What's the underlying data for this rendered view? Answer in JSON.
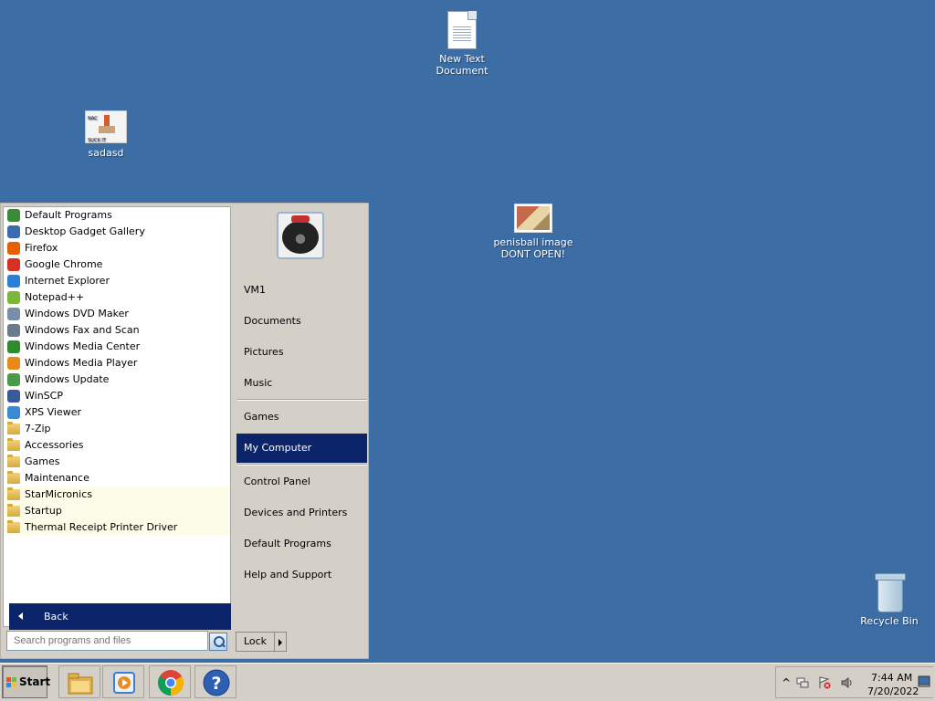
{
  "desktop": {
    "icons": [
      {
        "label": "New Text Document"
      },
      {
        "label": "sadasd",
        "thumb_top": "NAC",
        "thumb_bottom": "SUCK IT"
      },
      {
        "label": "penisball image DONT OPEN!"
      },
      {
        "label": "Recycle Bin"
      }
    ]
  },
  "start_menu": {
    "programs": [
      {
        "label": "Default Programs",
        "icon": "default-programs-icon",
        "color": "#3a8a3a"
      },
      {
        "label": "Desktop Gadget Gallery",
        "icon": "gadget-gallery-icon",
        "color": "#3a6ab0"
      },
      {
        "label": "Firefox",
        "icon": "firefox-icon",
        "color": "#e66000"
      },
      {
        "label": "Google Chrome",
        "icon": "chrome-icon",
        "color": "#d93025"
      },
      {
        "label": "Internet Explorer",
        "icon": "internet-explorer-icon",
        "color": "#2a7fd4"
      },
      {
        "label": "Notepad++",
        "icon": "notepad-plus-plus-icon",
        "color": "#7bb63a"
      },
      {
        "label": "Windows DVD Maker",
        "icon": "dvd-maker-icon",
        "color": "#7a8ea8"
      },
      {
        "label": "Windows Fax and Scan",
        "icon": "fax-scan-icon",
        "color": "#6b7b8b"
      },
      {
        "label": "Windows Media Center",
        "icon": "media-center-icon",
        "color": "#2d8a2d"
      },
      {
        "label": "Windows Media Player",
        "icon": "media-player-icon",
        "color": "#e88a1a"
      },
      {
        "label": "Windows Update",
        "icon": "windows-update-icon",
        "color": "#4a9a4a"
      },
      {
        "label": "WinSCP",
        "icon": "winscp-icon",
        "color": "#3a5a9a"
      },
      {
        "label": "XPS Viewer",
        "icon": "xps-viewer-icon",
        "color": "#3a8ad4"
      },
      {
        "label": "7-Zip",
        "icon": "folder-icon",
        "folder": true
      },
      {
        "label": "Accessories",
        "icon": "folder-icon",
        "folder": true
      },
      {
        "label": "Games",
        "icon": "folder-icon",
        "folder": true
      },
      {
        "label": "Maintenance",
        "icon": "folder-icon",
        "folder": true
      },
      {
        "label": "StarMicronics",
        "icon": "folder-icon",
        "folder": true,
        "highlight": true
      },
      {
        "label": "Startup",
        "icon": "folder-icon",
        "folder": true,
        "highlight": true
      },
      {
        "label": "Thermal Receipt Printer Driver",
        "icon": "folder-icon",
        "folder": true,
        "highlight": true
      }
    ],
    "back_label": "Back",
    "search_placeholder": "Search programs and files",
    "right_items": [
      {
        "label": "VM1"
      },
      {
        "label": "Documents"
      },
      {
        "label": "Pictures"
      },
      {
        "label": "Music"
      },
      {
        "label": "Games"
      },
      {
        "label": "My Computer",
        "selected": true
      },
      {
        "label": "Control Panel"
      },
      {
        "label": "Devices and Printers"
      },
      {
        "label": "Default Programs"
      },
      {
        "label": "Help and Support"
      }
    ],
    "lock_label": "Lock"
  },
  "taskbar": {
    "start_label": "Start",
    "pinned": [
      {
        "name": "explorer-icon"
      },
      {
        "name": "media-player-icon"
      },
      {
        "name": "chrome-icon"
      },
      {
        "name": "help-icon",
        "glyph": "?"
      }
    ],
    "tray": {
      "chevron": "^",
      "time": "7:44 AM",
      "date": "7/20/2022"
    }
  }
}
